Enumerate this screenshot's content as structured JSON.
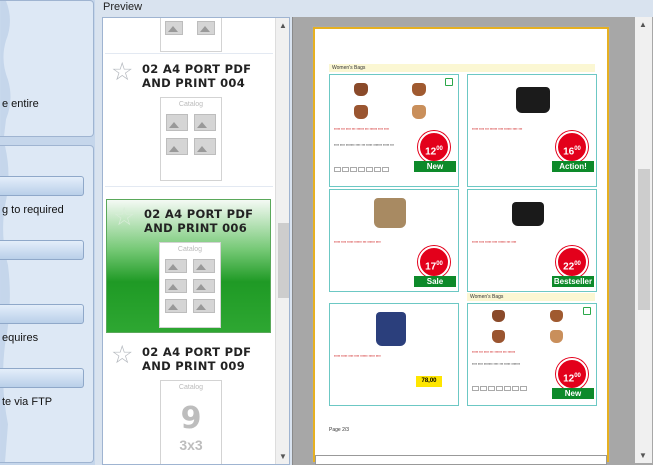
{
  "left_panel": {
    "text1": "e entire",
    "text2": "g to required",
    "text3": "equires",
    "text4": "te via FTP"
  },
  "preview_header": "Preview",
  "thumbnails": [
    {
      "title": "02 A4 PORT PDF AND PRINT 004",
      "caption": "Catalog",
      "selected": false
    },
    {
      "title": "02 A4 PORT PDF AND PRINT 006",
      "caption": "Catalog",
      "selected": true
    },
    {
      "title": "02 A4 PORT PDF AND PRINT 009",
      "caption": "Catalog",
      "selected": false,
      "big_label": "9",
      "sub_label": "3x3"
    }
  ],
  "page": {
    "section1": "Women's Bags",
    "section2": "Women's Bags",
    "page_label": "Page 2/3",
    "products": [
      {
        "price_int": "12",
        "price_dec": "00",
        "badge": "New"
      },
      {
        "price_int": "16",
        "price_dec": "00",
        "badge": "Action!"
      },
      {
        "price_int": "17",
        "price_dec": "00",
        "badge": "Sale"
      },
      {
        "price_int": "22",
        "price_dec": "00",
        "badge": "Bestseller"
      },
      {
        "yellow_price": "78,00"
      },
      {
        "price_int": "12",
        "price_dec": "00",
        "badge": "New"
      }
    ]
  },
  "colors": {
    "accent_green": "#1f9a25",
    "price_red": "#e3001b",
    "badge_green": "#0d8a2a",
    "page_border": "#e6b021"
  }
}
